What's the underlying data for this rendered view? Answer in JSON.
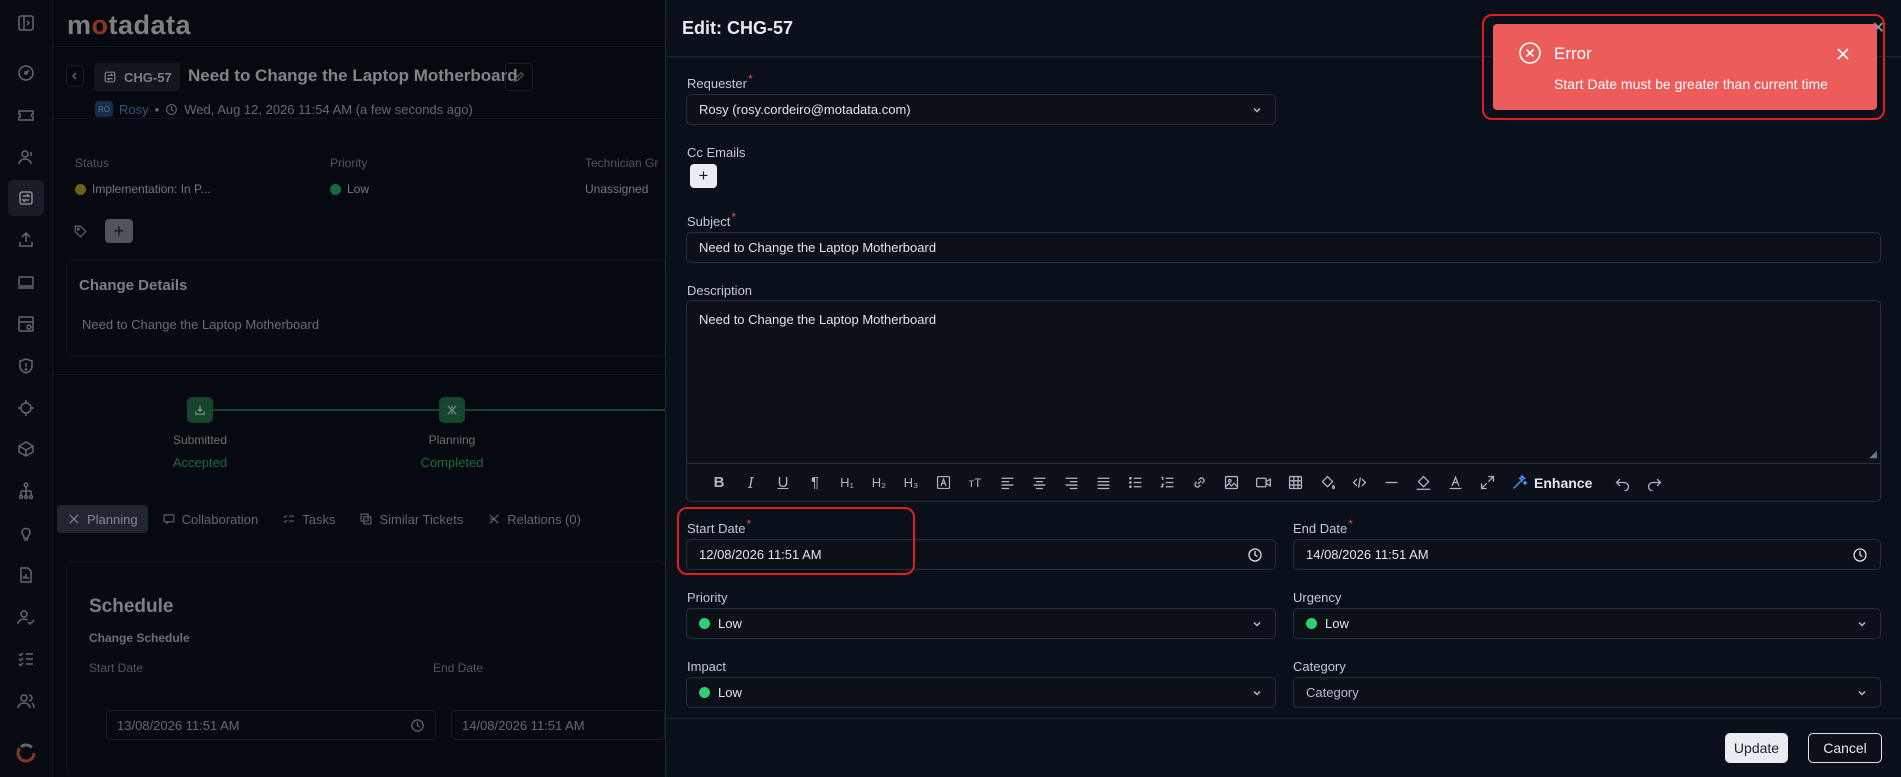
{
  "app": {
    "logo_pre": "m",
    "logo_dot": "o",
    "logo_post": "tadata"
  },
  "background": {
    "ticket_id": "CHG-57",
    "title": "Need to Change the Laptop Motherboard",
    "requester_initials": "RO",
    "requester_name": "Rosy",
    "timestamp": "Wed, Aug 12, 2026 11:54 AM (a few seconds ago)",
    "fields": [
      {
        "label": "Status",
        "value": "Implementation: In P...",
        "color": "#c9a227"
      },
      {
        "label": "Priority",
        "value": "Low",
        "color": "#2fb36a"
      },
      {
        "label": "Technician Gr",
        "value": "Unassigned"
      }
    ],
    "details_title": "Change Details",
    "details_text": "Need to Change the Laptop Motherboard",
    "steps": [
      {
        "label": "Submitted",
        "status": "Accepted"
      },
      {
        "label": "Planning",
        "status": "Completed"
      }
    ],
    "tabs": [
      "Planning",
      "Collaboration",
      "Tasks",
      "Similar Tickets",
      "Relations (0)"
    ],
    "schedule_title": "Schedule",
    "schedule_sub": "Change Schedule",
    "start_label": "Start Date",
    "start_value": "13/08/2026 11:51 AM",
    "end_label": "End Date",
    "end_value": "14/08/2026 11:51 AM"
  },
  "drawer": {
    "title": "Edit: CHG-57",
    "requester_label": "Requester",
    "requester_value": "Rosy (rosy.cordeiro@motadata.com)",
    "cc_label": "Cc Emails",
    "subject_label": "Subject",
    "subject_value": "Need to Change the Laptop Motherboard",
    "description_label": "Description",
    "description_value": "Need to Change the Laptop Motherboard",
    "enhance_label": "Enhance",
    "start_label": "Start Date",
    "start_value": "12/08/2026 11:51 AM",
    "end_label": "End Date",
    "end_value": "14/08/2026 11:51 AM",
    "priority_label": "Priority",
    "priority_value": "Low",
    "urgency_label": "Urgency",
    "urgency_value": "Low",
    "impact_label": "Impact",
    "impact_value": "Low",
    "category_label": "Category",
    "category_value": "Category",
    "low_color": "#2fd06e",
    "update_label": "Update",
    "cancel_label": "Cancel"
  },
  "toast": {
    "title": "Error",
    "message": "Start Date must be greater than current time",
    "color": "#ec5c5a"
  }
}
